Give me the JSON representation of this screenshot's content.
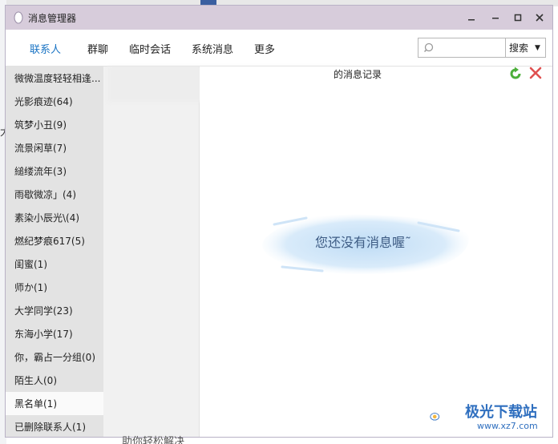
{
  "window": {
    "title": "消息管理器",
    "controls": [
      "minimize",
      "restore",
      "maximize",
      "close"
    ]
  },
  "tabs": [
    {
      "label": "联系人",
      "active": true
    },
    {
      "label": "群聊",
      "active": false
    },
    {
      "label": "临时会话",
      "active": false
    },
    {
      "label": "系统消息",
      "active": false
    },
    {
      "label": "更多",
      "active": false
    }
  ],
  "search": {
    "value": "",
    "button_label": "搜索"
  },
  "groups": [
    {
      "label": "微微温度轻轻相逢..."
    },
    {
      "label": "光影痕迹(64)"
    },
    {
      "label": "筑梦小丑(9)"
    },
    {
      "label": "流景闲草(7)"
    },
    {
      "label": "縋缕流年(3)"
    },
    {
      "label": "雨歇微凉」(4)"
    },
    {
      "label": "素染小辰光\\(4)"
    },
    {
      "label": "燃纪梦痕617(5)"
    },
    {
      "label": "闺蜜(1)"
    },
    {
      "label": "师か(1)"
    },
    {
      "label": "大学同学(23)"
    },
    {
      "label": "东海小学(17)"
    },
    {
      "label": "你，霸占一分组(0)"
    },
    {
      "label": "陌生人(0)"
    },
    {
      "label": "黑名单(1)",
      "selected": true
    },
    {
      "label": "已删除联系人(1)"
    }
  ],
  "record": {
    "title_fragment": "的消息记录"
  },
  "empty_state": {
    "text": "您还没有消息喔˜"
  },
  "background": {
    "bottom_text": "助你轻松解决",
    "side_char": "大"
  },
  "watermark": {
    "name": "极光下载站",
    "url": "www.xz7.com"
  },
  "colors": {
    "titlebar": "#d7ccdb",
    "active_tab": "#1a74c4",
    "left_pane": "#e3e3e3",
    "empty_text": "#3e5c84",
    "refresh_green": "#4caf3a",
    "delete_red": "#e05050"
  }
}
